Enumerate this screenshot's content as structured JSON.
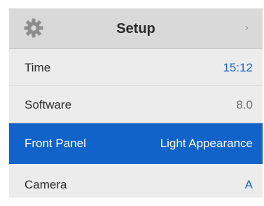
{
  "header": {
    "title": "Setup",
    "icon": "gear-icon",
    "chevron": "›"
  },
  "rows": [
    {
      "label": "Time",
      "value": "15:12",
      "value_color": "#1f63c6"
    },
    {
      "label": "Software",
      "value": "8.0",
      "value_color": "#6f6f6f"
    },
    {
      "label": "Front Panel",
      "value": "Light Appearance",
      "selected": true
    },
    {
      "label": "Camera",
      "value": "A",
      "value_color": "#1f63c6"
    }
  ],
  "colors": {
    "header_bg": "#d9d9d9",
    "row_bg": "#ececec",
    "selected_bg": "#1263c9",
    "accent": "#1f63c6"
  }
}
